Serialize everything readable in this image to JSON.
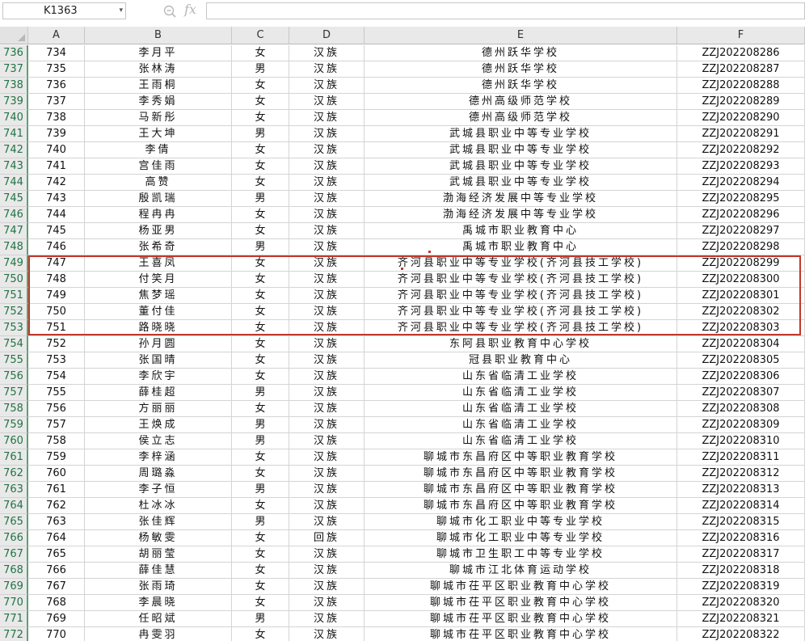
{
  "formula_bar": {
    "name_box": "K1363",
    "fx_label": "fx",
    "formula": ""
  },
  "columns": [
    "A",
    "B",
    "C",
    "D",
    "E",
    "F"
  ],
  "colors": {
    "row_number_text": "#217346",
    "highlight_border": "#c0392b"
  },
  "rows": [
    {
      "n": "736",
      "A": "734",
      "B": "李月平",
      "C": "女",
      "D": "汉族",
      "E": "德州跃华学校",
      "F": "ZZJ202208286"
    },
    {
      "n": "737",
      "A": "735",
      "B": "张林涛",
      "C": "男",
      "D": "汉族",
      "E": "德州跃华学校",
      "F": "ZZJ202208287"
    },
    {
      "n": "738",
      "A": "736",
      "B": "王雨桐",
      "C": "女",
      "D": "汉族",
      "E": "德州跃华学校",
      "F": "ZZJ202208288"
    },
    {
      "n": "739",
      "A": "737",
      "B": "李秀娟",
      "C": "女",
      "D": "汉族",
      "E": "德州高级师范学校",
      "F": "ZZJ202208289"
    },
    {
      "n": "740",
      "A": "738",
      "B": "马新彤",
      "C": "女",
      "D": "汉族",
      "E": "德州高级师范学校",
      "F": "ZZJ202208290"
    },
    {
      "n": "741",
      "A": "739",
      "B": "王大坤",
      "C": "男",
      "D": "汉族",
      "E": "武城县职业中等专业学校",
      "F": "ZZJ202208291"
    },
    {
      "n": "742",
      "A": "740",
      "B": "李倩",
      "C": "女",
      "D": "汉族",
      "E": "武城县职业中等专业学校",
      "F": "ZZJ202208292"
    },
    {
      "n": "743",
      "A": "741",
      "B": "宫佳雨",
      "C": "女",
      "D": "汉族",
      "E": "武城县职业中等专业学校",
      "F": "ZZJ202208293"
    },
    {
      "n": "744",
      "A": "742",
      "B": "高赞",
      "C": "女",
      "D": "汉族",
      "E": "武城县职业中等专业学校",
      "F": "ZZJ202208294"
    },
    {
      "n": "745",
      "A": "743",
      "B": "殷凯瑞",
      "C": "男",
      "D": "汉族",
      "E": "渤海经济发展中等专业学校",
      "F": "ZZJ202208295"
    },
    {
      "n": "746",
      "A": "744",
      "B": "程冉冉",
      "C": "女",
      "D": "汉族",
      "E": "渤海经济发展中等专业学校",
      "F": "ZZJ202208296"
    },
    {
      "n": "747",
      "A": "745",
      "B": "杨亚男",
      "C": "女",
      "D": "汉族",
      "E": "禹城市职业教育中心",
      "F": "ZZJ202208297"
    },
    {
      "n": "748",
      "A": "746",
      "B": "张希奇",
      "C": "男",
      "D": "汉族",
      "E": "禹城市职业教育中心",
      "F": "ZZJ202208298"
    },
    {
      "n": "749",
      "A": "747",
      "B": "王喜凤",
      "C": "女",
      "D": "汉族",
      "E": "齐河县职业中等专业学校(齐河县技工学校)",
      "F": "ZZJ202208299"
    },
    {
      "n": "750",
      "A": "748",
      "B": "付笑月",
      "C": "女",
      "D": "汉族",
      "E": "齐河县职业中等专业学校(齐河县技工学校)",
      "F": "ZZJ202208300"
    },
    {
      "n": "751",
      "A": "749",
      "B": "焦梦瑶",
      "C": "女",
      "D": "汉族",
      "E": "齐河县职业中等专业学校(齐河县技工学校)",
      "F": "ZZJ202208301"
    },
    {
      "n": "752",
      "A": "750",
      "B": "董付佳",
      "C": "女",
      "D": "汉族",
      "E": "齐河县职业中等专业学校(齐河县技工学校)",
      "F": "ZZJ202208302"
    },
    {
      "n": "753",
      "A": "751",
      "B": "路晓晓",
      "C": "女",
      "D": "汉族",
      "E": "齐河县职业中等专业学校(齐河县技工学校)",
      "F": "ZZJ202208303"
    },
    {
      "n": "754",
      "A": "752",
      "B": "孙月圆",
      "C": "女",
      "D": "汉族",
      "E": "东阿县职业教育中心学校",
      "F": "ZZJ202208304"
    },
    {
      "n": "755",
      "A": "753",
      "B": "张国晴",
      "C": "女",
      "D": "汉族",
      "E": "冠县职业教育中心",
      "F": "ZZJ202208305"
    },
    {
      "n": "756",
      "A": "754",
      "B": "李欣宇",
      "C": "女",
      "D": "汉族",
      "E": "山东省临清工业学校",
      "F": "ZZJ202208306"
    },
    {
      "n": "757",
      "A": "755",
      "B": "薛桂超",
      "C": "男",
      "D": "汉族",
      "E": "山东省临清工业学校",
      "F": "ZZJ202208307"
    },
    {
      "n": "758",
      "A": "756",
      "B": "方丽丽",
      "C": "女",
      "D": "汉族",
      "E": "山东省临清工业学校",
      "F": "ZZJ202208308"
    },
    {
      "n": "759",
      "A": "757",
      "B": "王焕成",
      "C": "男",
      "D": "汉族",
      "E": "山东省临清工业学校",
      "F": "ZZJ202208309"
    },
    {
      "n": "760",
      "A": "758",
      "B": "侯立志",
      "C": "男",
      "D": "汉族",
      "E": "山东省临清工业学校",
      "F": "ZZJ202208310"
    },
    {
      "n": "761",
      "A": "759",
      "B": "李梓涵",
      "C": "女",
      "D": "汉族",
      "E": "聊城市东昌府区中等职业教育学校",
      "F": "ZZJ202208311"
    },
    {
      "n": "762",
      "A": "760",
      "B": "周璐淼",
      "C": "女",
      "D": "汉族",
      "E": "聊城市东昌府区中等职业教育学校",
      "F": "ZZJ202208312"
    },
    {
      "n": "763",
      "A": "761",
      "B": "李子恒",
      "C": "男",
      "D": "汉族",
      "E": "聊城市东昌府区中等职业教育学校",
      "F": "ZZJ202208313"
    },
    {
      "n": "764",
      "A": "762",
      "B": "杜冰冰",
      "C": "女",
      "D": "汉族",
      "E": "聊城市东昌府区中等职业教育学校",
      "F": "ZZJ202208314"
    },
    {
      "n": "765",
      "A": "763",
      "B": "张佳辉",
      "C": "男",
      "D": "汉族",
      "E": "聊城市化工职业中等专业学校",
      "F": "ZZJ202208315"
    },
    {
      "n": "766",
      "A": "764",
      "B": "杨敏雯",
      "C": "女",
      "D": "回族",
      "E": "聊城市化工职业中等专业学校",
      "F": "ZZJ202208316"
    },
    {
      "n": "767",
      "A": "765",
      "B": "胡丽莹",
      "C": "女",
      "D": "汉族",
      "E": "聊城市卫生职工中等专业学校",
      "F": "ZZJ202208317"
    },
    {
      "n": "768",
      "A": "766",
      "B": "薛佳慧",
      "C": "女",
      "D": "汉族",
      "E": "聊城市江北体育运动学校",
      "F": "ZZJ202208318"
    },
    {
      "n": "769",
      "A": "767",
      "B": "张雨琦",
      "C": "女",
      "D": "汉族",
      "E": "聊城市茌平区职业教育中心学校",
      "F": "ZZJ202208319"
    },
    {
      "n": "770",
      "A": "768",
      "B": "李晨晓",
      "C": "女",
      "D": "汉族",
      "E": "聊城市茌平区职业教育中心学校",
      "F": "ZZJ202208320"
    },
    {
      "n": "771",
      "A": "769",
      "B": "任昭斌",
      "C": "男",
      "D": "汉族",
      "E": "聊城市茌平区职业教育中心学校",
      "F": "ZZJ202208321"
    },
    {
      "n": "772",
      "A": "770",
      "B": "冉雯羽",
      "C": "女",
      "D": "汉族",
      "E": "聊城市茌平区职业教育中心学校",
      "F": "ZZJ202208322"
    }
  ]
}
